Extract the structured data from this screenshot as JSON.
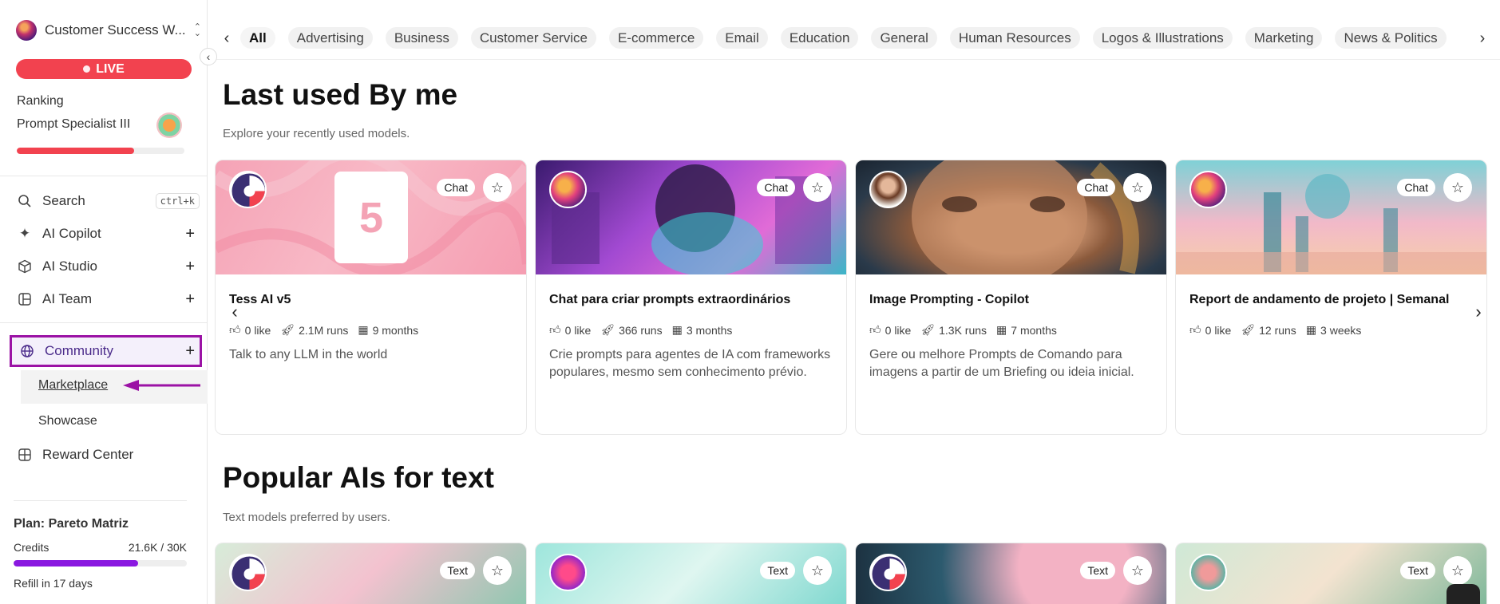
{
  "sidebar": {
    "workspace_name": "Customer Success W...",
    "live_label": "LIVE",
    "ranking_label": "Ranking",
    "ranking_title": "Prompt Specialist III",
    "ranking_progress": 0.7,
    "search_label": "Search",
    "search_shortcut": "ctrl+k",
    "items": [
      {
        "label": "AI Copilot"
      },
      {
        "label": "AI Studio"
      },
      {
        "label": "AI Team"
      }
    ],
    "community_label": "Community",
    "marketplace_label": "Marketplace",
    "showcase_label": "Showcase",
    "reward_label": "Reward Center",
    "plan_title": "Plan: Pareto Matriz",
    "credits_label": "Credits",
    "credits_value": "21.6K / 30K",
    "credits_progress": 0.72,
    "refill_text": "Refill in 17 days",
    "accent_color": "#9b12a5",
    "live_color": "#f2424f"
  },
  "categories": [
    "All",
    "Advertising",
    "Business",
    "Customer Service",
    "E-commerce",
    "Email",
    "Education",
    "General",
    "Human Resources",
    "Logos & Illustrations",
    "Marketing",
    "News & Politics"
  ],
  "last_used": {
    "title": "Last used By me",
    "subtitle": "Explore your recently used models.",
    "cards": [
      {
        "tag": "Chat",
        "title": "Tess AI v5",
        "likes": "0 like",
        "runs": "2.1M runs",
        "age": "9 months",
        "desc": "Talk to any LLM in the world"
      },
      {
        "tag": "Chat",
        "title": "Chat para criar prompts extraordinários",
        "likes": "0 like",
        "runs": "366 runs",
        "age": "3 months",
        "desc": "Crie prompts para agentes de IA com frameworks populares, mesmo sem conhecimento prévio."
      },
      {
        "tag": "Chat",
        "title": "Image Prompting - Copilot",
        "likes": "0 like",
        "runs": "1.3K runs",
        "age": "7 months",
        "desc": "Gere ou melhore Prompts de Comando para imagens a partir de um Briefing ou ideia inicial."
      },
      {
        "tag": "Chat",
        "title": "Report de andamento de projeto | Semanal",
        "likes": "0 like",
        "runs": "12 runs",
        "age": "3 weeks",
        "desc": ""
      }
    ]
  },
  "popular": {
    "title": "Popular AIs for text",
    "subtitle": "Text models preferred by users.",
    "cards": [
      {
        "tag": "Text"
      },
      {
        "tag": "Text"
      },
      {
        "tag": "Text"
      },
      {
        "tag": "Text"
      }
    ]
  },
  "tess_card_number": "5"
}
